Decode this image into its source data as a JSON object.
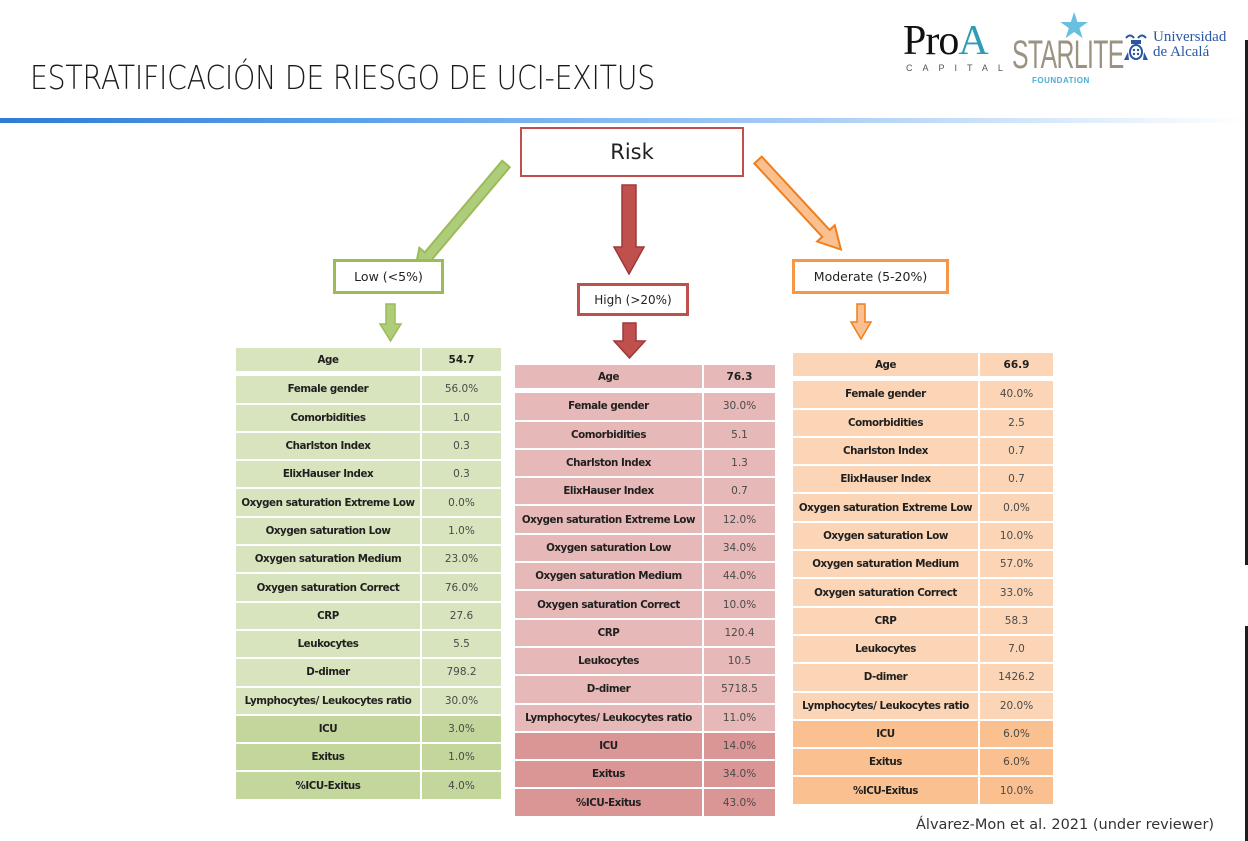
{
  "slide": {
    "title": "ESTRATIFICACIÓN DE RIESGO DE UCI-EXITUS",
    "citation": "Álvarez-Mon et al. 2021 (under reviewer)"
  },
  "logos": {
    "proa": {
      "word_main": "Pro",
      "word_accent": "A",
      "subtitle": "CAPITAL"
    },
    "starlite": {
      "word": "STARLITE",
      "subtitle": "FOUNDATION",
      "icon": "star-icon"
    },
    "uah": {
      "line1": "Universidad",
      "line2": "de Alcalá",
      "icon": "crest-icon"
    }
  },
  "diagram": {
    "root_label": "Risk",
    "colors": {
      "low": "#9bbb59",
      "high": "#c0504d",
      "moderate": "#f79646"
    },
    "groups": {
      "low": {
        "label": "Low (<5%)",
        "rows": [
          {
            "label": "Age",
            "value": "54.7"
          },
          {
            "label": "Female gender",
            "value": "56.0%"
          },
          {
            "label": "Comorbidities",
            "value": "1.0"
          },
          {
            "label": "Charlston Index",
            "value": "0.3"
          },
          {
            "label": "ElixHauser Index",
            "value": "0.3"
          },
          {
            "label": "Oxygen saturation Extreme Low",
            "value": "0.0%"
          },
          {
            "label": "Oxygen saturation Low",
            "value": "1.0%"
          },
          {
            "label": "Oxygen saturation Medium",
            "value": "23.0%"
          },
          {
            "label": "Oxygen saturation Correct",
            "value": "76.0%"
          },
          {
            "label": "CRP",
            "value": "27.6"
          },
          {
            "label": "Leukocytes",
            "value": "5.5"
          },
          {
            "label": "D-dimer",
            "value": "798.2"
          },
          {
            "label": "Lymphocytes/ Leukocytes ratio",
            "value": "30.0%"
          },
          {
            "label": "ICU",
            "value": "3.0%"
          },
          {
            "label": "Exitus",
            "value": "1.0%"
          },
          {
            "label": "%ICU-Exitus",
            "value": "4.0%"
          }
        ]
      },
      "high": {
        "label": "High (>20%)",
        "rows": [
          {
            "label": "Age",
            "value": "76.3"
          },
          {
            "label": "Female gender",
            "value": "30.0%"
          },
          {
            "label": "Comorbidities",
            "value": "5.1"
          },
          {
            "label": "Charlston Index",
            "value": "1.3"
          },
          {
            "label": "ElixHauser Index",
            "value": "0.7"
          },
          {
            "label": "Oxygen saturation Extreme Low",
            "value": "12.0%"
          },
          {
            "label": "Oxygen saturation Low",
            "value": "34.0%"
          },
          {
            "label": "Oxygen saturation Medium",
            "value": "44.0%"
          },
          {
            "label": "Oxygen saturation Correct",
            "value": "10.0%"
          },
          {
            "label": "CRP",
            "value": "120.4"
          },
          {
            "label": "Leukocytes",
            "value": "10.5"
          },
          {
            "label": "D-dimer",
            "value": "5718.5"
          },
          {
            "label": "Lymphocytes/ Leukocytes ratio",
            "value": "11.0%"
          },
          {
            "label": "ICU",
            "value": "14.0%"
          },
          {
            "label": "Exitus",
            "value": "34.0%"
          },
          {
            "label": "%ICU-Exitus",
            "value": "43.0%"
          }
        ]
      },
      "moderate": {
        "label": "Moderate (5-20%)",
        "rows": [
          {
            "label": "Age",
            "value": "66.9"
          },
          {
            "label": "Female gender",
            "value": "40.0%"
          },
          {
            "label": "Comorbidities",
            "value": "2.5"
          },
          {
            "label": "Charlston Index",
            "value": "0.7"
          },
          {
            "label": "ElixHauser Index",
            "value": "0.7"
          },
          {
            "label": "Oxygen saturation Extreme Low",
            "value": "0.0%"
          },
          {
            "label": "Oxygen saturation Low",
            "value": "10.0%"
          },
          {
            "label": "Oxygen saturation Medium",
            "value": "57.0%"
          },
          {
            "label": "Oxygen saturation Correct",
            "value": "33.0%"
          },
          {
            "label": "CRP",
            "value": "58.3"
          },
          {
            "label": "Leukocytes",
            "value": "7.0"
          },
          {
            "label": "D-dimer",
            "value": "1426.2"
          },
          {
            "label": "Lymphocytes/ Leukocytes ratio",
            "value": "20.0%"
          },
          {
            "label": "ICU",
            "value": "6.0%"
          },
          {
            "label": "Exitus",
            "value": "6.0%"
          },
          {
            "label": "%ICU-Exitus",
            "value": "10.0%"
          }
        ]
      }
    }
  }
}
